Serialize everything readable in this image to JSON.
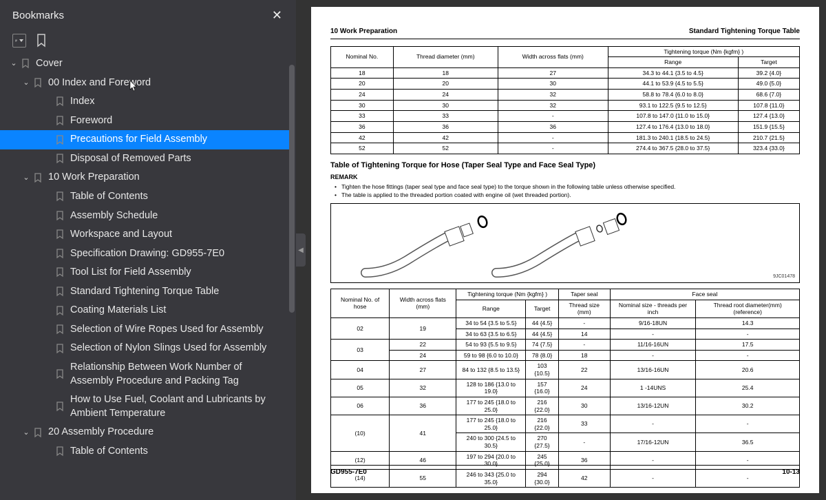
{
  "sidebar": {
    "title": "Bookmarks",
    "tree": [
      {
        "label": "Cover",
        "depth": 0,
        "expand": "open",
        "sel": false
      },
      {
        "label": "00 Index and Foreword",
        "depth": 1,
        "expand": "open",
        "sel": false
      },
      {
        "label": "Index",
        "depth": 2,
        "expand": "",
        "sel": false
      },
      {
        "label": "Foreword",
        "depth": 2,
        "expand": "",
        "sel": false
      },
      {
        "label": "Precautions for Field Assembly",
        "depth": 2,
        "expand": "",
        "sel": true
      },
      {
        "label": "Disposal of Removed Parts",
        "depth": 2,
        "expand": "",
        "sel": false
      },
      {
        "label": "10 Work Preparation",
        "depth": 1,
        "expand": "open",
        "sel": false
      },
      {
        "label": "Table of Contents",
        "depth": 2,
        "expand": "",
        "sel": false
      },
      {
        "label": "Assembly Schedule",
        "depth": 2,
        "expand": "",
        "sel": false
      },
      {
        "label": "Workspace and Layout",
        "depth": 2,
        "expand": "",
        "sel": false
      },
      {
        "label": "Specification Drawing: GD955-7E0",
        "depth": 2,
        "expand": "",
        "sel": false
      },
      {
        "label": "Tool List for Field Assembly",
        "depth": 2,
        "expand": "",
        "sel": false
      },
      {
        "label": "Standard Tightening Torque Table",
        "depth": 2,
        "expand": "",
        "sel": false
      },
      {
        "label": "Coating Materials List",
        "depth": 2,
        "expand": "",
        "sel": false
      },
      {
        "label": "Selection of Wire Ropes Used for Assembly",
        "depth": 2,
        "expand": "",
        "sel": false
      },
      {
        "label": "Selection of Nylon Slings Used for Assembly",
        "depth": 2,
        "expand": "",
        "sel": false
      },
      {
        "label": " Relationship Between Work Number of Assembly Procedure and Packing Tag",
        "depth": 2,
        "expand": "",
        "sel": false
      },
      {
        "label": " How to Use Fuel, Coolant and Lubricants by Ambient Temperature",
        "depth": 2,
        "expand": "",
        "sel": false
      },
      {
        "label": "20 Assembly Procedure",
        "depth": 1,
        "expand": "open",
        "sel": false
      },
      {
        "label": "Table of Contents",
        "depth": 2,
        "expand": "",
        "sel": false
      }
    ]
  },
  "page": {
    "header_left": "10 Work Preparation",
    "header_right": "Standard Tightening Torque Table",
    "footer_left": "GD955-7E0",
    "footer_right": "10-13",
    "table1_caption_group": "Tightening torque (Nm {kgfm} )",
    "table1_headers": [
      "Nominal No.",
      "Thread diameter (mm)",
      "Width across flats (mm)",
      "Range",
      "Target"
    ],
    "table1_rows": [
      [
        "18",
        "18",
        "27",
        "34.3 to 44.1 {3.5 to 4.5}",
        "39.2 {4.0}"
      ],
      [
        "20",
        "20",
        "30",
        "44.1 to 53.9 {4.5 to 5.5}",
        "49.0 {5.0}"
      ],
      [
        "24",
        "24",
        "32",
        "58.8 to 78.4 {6.0 to 8.0}",
        "68.6 {7.0}"
      ],
      [
        "30",
        "30",
        "32",
        "93.1 to 122.5 {9.5 to 12.5}",
        "107.8 {11.0}"
      ],
      [
        "33",
        "33",
        "-",
        "107.8 to 147.0 {11.0 to 15.0}",
        "127.4 {13.0}"
      ],
      [
        "36",
        "36",
        "36",
        "127.4 to 176.4 {13.0 to 18.0}",
        "151.9 {15.5}"
      ],
      [
        "42",
        "42",
        "-",
        "181.3 to 240.1 {18.5 to 24.5}",
        "210.7 {21.5}"
      ],
      [
        "52",
        "52",
        "-",
        "274.4 to 367.5 {28.0 to 37.5}",
        "323.4 {33.0}"
      ]
    ],
    "section_title": "Table of Tightening Torque for Hose (Taper Seal Type and Face Seal Type)",
    "remark_label": "REMARK",
    "bullets": [
      "Tighten the hose fittings (taper seal type and face seal type) to the torque shown in the following table unless otherwise specified.",
      "The table is applied to the threaded portion coated with engine oil (wet threaded portion)."
    ],
    "figure_id": "9JC01478",
    "table2_top_headers": {
      "nom": "Nominal No. of hose",
      "width": "Width across flats (mm)",
      "torque_group": "Tightening torque (Nm {kgfm} )",
      "range": "Range",
      "target": "Target",
      "taper": "Taper seal",
      "thread": "Thread size (mm)",
      "face": "Face seal",
      "nomsize": "Nominal size - threads per inch",
      "root": "Thread root diameter(mm) (reference)"
    },
    "table2_rows": [
      {
        "nom": "02",
        "nomspan": 2,
        "w": "19",
        "wspan": 2,
        "range": "34 to 54 {3.5 to 5.5}",
        "target": "44 {4.5}",
        "thread": "-",
        "nomsize": "9/16-18UN",
        "root": "14.3"
      },
      {
        "range": "34 to 63 {3.5 to 6.5}",
        "target": "44 {4.5}",
        "thread": "14",
        "nomsize": "-",
        "root": "-"
      },
      {
        "nom": "03",
        "nomspan": 2,
        "w": "22",
        "range": "54 to 93 {5.5 to 9.5}",
        "target": "74 {7.5}",
        "thread": "-",
        "nomsize": "11/16-16UN",
        "root": "17.5"
      },
      {
        "w": "24",
        "range": "59 to 98 {6.0 to 10.0}",
        "target": "78 {8.0}",
        "thread": "18",
        "nomsize": "-",
        "root": "-"
      },
      {
        "nom": "04",
        "w": "27",
        "range": "84 to 132 {8.5 to 13.5}",
        "target": "103 {10.5}",
        "thread": "22",
        "nomsize": "13/16-16UN",
        "root": "20.6"
      },
      {
        "nom": "05",
        "w": "32",
        "range": "128 to 186 {13.0 to 19.0}",
        "target": "157 {16.0}",
        "thread": "24",
        "nomsize": "1 -14UNS",
        "root": "25.4"
      },
      {
        "nom": "06",
        "w": "36",
        "range": "177 to 245 {18.0 to 25.0}",
        "target": "216 {22.0}",
        "thread": "30",
        "nomsize": "13/16-12UN",
        "root": "30.2"
      },
      {
        "nom": "(10)",
        "nomspan": 2,
        "w": "41",
        "wspan": 2,
        "range": "177 to 245 {18.0 to 25.0}",
        "target": "216 {22.0}",
        "thread": "33",
        "nomsize": "-",
        "root": "-"
      },
      {
        "range": "240 to 300 {24.5 to 30.5}",
        "target": "270 {27.5}",
        "thread": "-",
        "nomsize": "17/16-12UN",
        "root": "36.5"
      },
      {
        "nom": "(12)",
        "w": "46",
        "range": "197 to 294 {20.0 to 30.0}",
        "target": "245 {25.0}",
        "thread": "36",
        "nomsize": "-",
        "root": "-"
      },
      {
        "nom": "(14)",
        "w": "55",
        "range": "246 to 343 {25.0 to 35.0}",
        "target": "294 {30.0}",
        "thread": "42",
        "nomsize": "-",
        "root": "-"
      }
    ]
  }
}
